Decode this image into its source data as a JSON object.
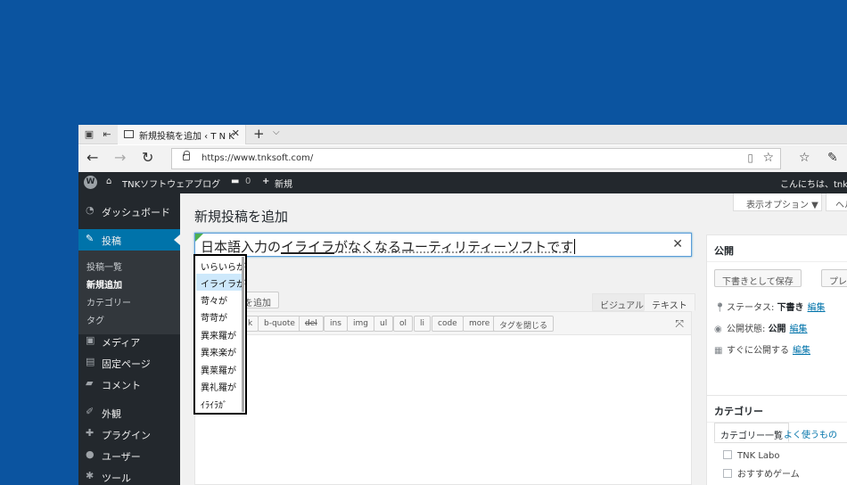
{
  "browser": {
    "tab_title": "新規投稿を追加 ‹ T N K",
    "url": "https://www.tnksoft.com/"
  },
  "adminbar": {
    "site_name": "TNKソフトウェアブログ",
    "comments_count": "0",
    "new_label": "新規",
    "greeting": "こんにちは、tnks"
  },
  "sidebar": {
    "items": [
      {
        "label": "ダッシュボード",
        "icon": "dashboard-icon"
      },
      {
        "label": "投稿",
        "icon": "pin-icon"
      },
      {
        "label": "メディア",
        "icon": "media-icon"
      },
      {
        "label": "固定ページ",
        "icon": "page-icon"
      },
      {
        "label": "コメント",
        "icon": "comment-icon"
      },
      {
        "label": "外観",
        "icon": "brush-icon"
      },
      {
        "label": "プラグイン",
        "icon": "plugin-icon"
      },
      {
        "label": "ユーザー",
        "icon": "user-icon"
      },
      {
        "label": "ツール",
        "icon": "wrench-icon"
      }
    ],
    "submenu": [
      "投稿一覧",
      "新規追加",
      "カテゴリー",
      "タグ"
    ]
  },
  "main": {
    "screen_options": "表示オプション ▼",
    "help": "ヘル",
    "page_title": "新規投稿を追加",
    "title_before": "日本語入力の",
    "title_converting": "イライラ",
    "title_after": "がなくなるユーティリティーソフトです",
    "media_button": "を追加",
    "tab_visual": "ビジュアル",
    "tab_text": "テキスト",
    "quicktags": [
      "k",
      "b-quote",
      "del",
      "ins",
      "img",
      "ul",
      "ol",
      "li",
      "code",
      "more",
      "タグを閉じる"
    ]
  },
  "publish": {
    "heading": "公開",
    "save_draft": "下書きとして保存",
    "preview": "プレビ",
    "status_label": "ステータス:",
    "status_value": "下書き",
    "visibility_label": "公開状態:",
    "visibility_value": "公開",
    "schedule_label": "すぐに公開する",
    "edit": "編集"
  },
  "categories": {
    "heading": "カテゴリー",
    "tab_all": "カテゴリー一覧",
    "tab_popular": "よく使うもの",
    "items": [
      "TNK Labo",
      "おすすめゲーム"
    ]
  },
  "ime": {
    "candidates": [
      "いらいらが",
      "イライラが",
      "苛々が",
      "苛苛が",
      "異来羅が",
      "異来楽が",
      "異莱羅が",
      "異礼羅が",
      "ｲﾗｲﾗｶﾞ"
    ],
    "selected_index": 1
  }
}
